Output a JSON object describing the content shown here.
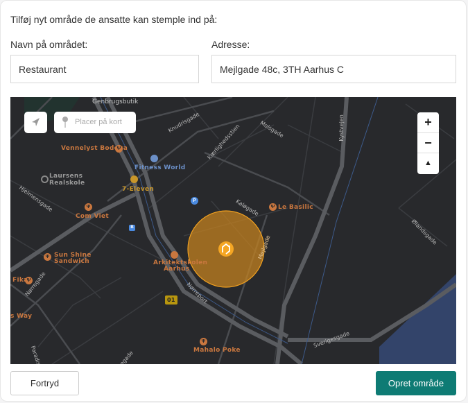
{
  "form": {
    "title": "Tilføj nyt område de ansatte kan stemple ind på:",
    "name_label": "Navn på området:",
    "name_value": "Restaurant",
    "address_label": "Adresse:",
    "address_value": "Mejlgade 48c, 3TH Aarhus C"
  },
  "map": {
    "place_placeholder": "Placer på kort",
    "zoom_in": "+",
    "zoom_out": "−",
    "compass": "▲",
    "pois": {
      "genbrugsbutik": "Genbrugsbutik",
      "vennelyst": "Vennelyst Bodega",
      "fitness": "Fitness World",
      "laursens1": "Laursens",
      "laursens2": "Realskole",
      "seven": "7-Eleven",
      "comviet": "Com Viet",
      "basilic": "Le Basilic",
      "sunshine1": "Sun Shine",
      "sunshine2": "Sandwich",
      "arkitekt1": "Arkitektskolen",
      "arkitekt2": "Aarhus",
      "fika": "Fika",
      "way": "s Way",
      "mahalo": "Mahalo Poke",
      "parking": "P",
      "route": "01",
      "bus": "B"
    },
    "streets": {
      "knudrisgade": "Knudrisgade",
      "kaerlighed": "Kærlighedsstien",
      "molsgade": "Molsgade",
      "kystvejen": "Kystvejen",
      "kalogade": "Kaløgade",
      "mejlgade": "Mejlgade",
      "hjelmensgade": "Hjelmensgade",
      "norregade": "Nørregade",
      "norreport": "Nørreport",
      "olandsgade": "Ølandsgade",
      "sverigesgade": "Sverigesgade",
      "paradis": "Paradis",
      "egade": "egade"
    },
    "circle_color": "#f0a020",
    "water_color": "#33446a"
  },
  "actions": {
    "cancel": "Fortryd",
    "create": "Opret område",
    "create_color": "#0e7b74"
  }
}
